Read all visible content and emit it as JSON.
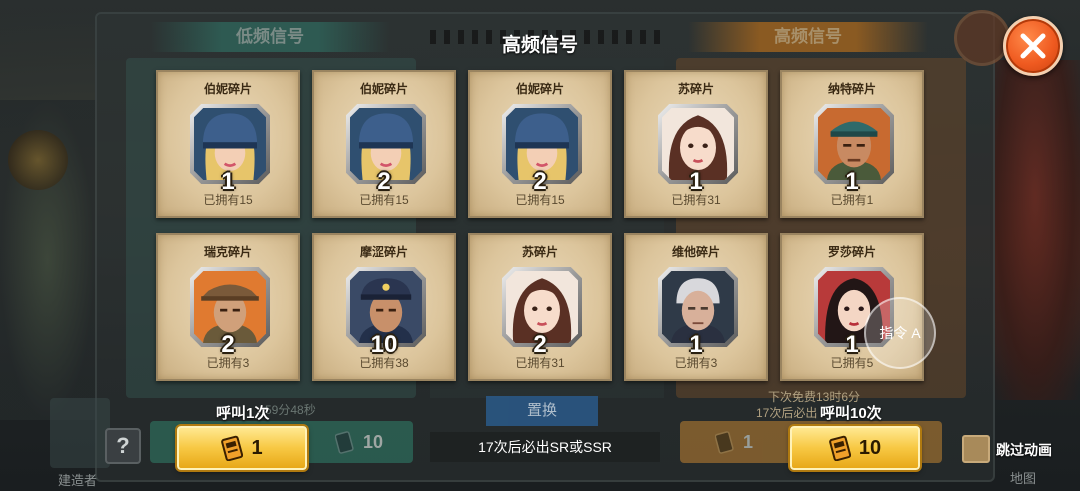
{
  "background": {
    "tab_left": "低频信号",
    "tab_right": "高频信号",
    "timer": "59分48秒",
    "next_free": "下次免费13时6分",
    "guarantee_hint": "17次后必出",
    "replace": "置换",
    "build_label": "建造者",
    "map_label": "地图",
    "left_call_count": "10",
    "right_call_count": "1"
  },
  "dialog": {
    "title": "高频信号",
    "close_icon": "close-x-icon"
  },
  "cards": [
    {
      "name": "伯妮碎片",
      "count": "1",
      "owned": "已拥有15",
      "portrait": "bernie"
    },
    {
      "name": "伯妮碎片",
      "count": "2",
      "owned": "已拥有15",
      "portrait": "bernie"
    },
    {
      "name": "伯妮碎片",
      "count": "2",
      "owned": "已拥有15",
      "portrait": "bernie"
    },
    {
      "name": "苏碎片",
      "count": "1",
      "owned": "已拥有31",
      "portrait": "su"
    },
    {
      "name": "纳特碎片",
      "count": "1",
      "owned": "已拥有1",
      "portrait": "nate"
    },
    {
      "name": "瑞克碎片",
      "count": "2",
      "owned": "已拥有3",
      "portrait": "rick"
    },
    {
      "name": "摩涩碎片",
      "count": "10",
      "owned": "已拥有38",
      "portrait": "mose"
    },
    {
      "name": "苏碎片",
      "count": "2",
      "owned": "已拥有31",
      "portrait": "su"
    },
    {
      "name": "维他碎片",
      "count": "1",
      "owned": "已拥有3",
      "portrait": "vita"
    },
    {
      "name": "罗莎碎片",
      "count": "1",
      "owned": "已拥有5",
      "portrait": "rosa"
    }
  ],
  "bottom": {
    "help": "?",
    "call_once_label": "呼叫1次",
    "call_once_cost": "1",
    "call_ten_label": "呼叫10次",
    "call_ten_cost": "10",
    "guarantee": "17次后必出SR或SSR",
    "skip_animation": "跳过动画",
    "command": "指令 A"
  },
  "colors": {
    "accent_orange": "#ef5a20",
    "button_gold": "#f7c843",
    "card_parchment": "#e2cfa9"
  }
}
